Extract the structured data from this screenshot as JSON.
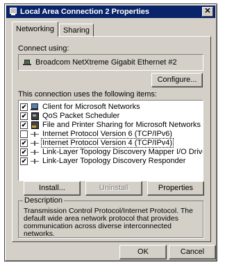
{
  "window": {
    "title": "Local Area Connection 2 Properties",
    "close_glyph": "✕"
  },
  "tabs": [
    {
      "label": "Networking",
      "active": true
    },
    {
      "label": "Sharing",
      "active": false
    }
  ],
  "connect_using": {
    "label": "Connect using:",
    "adapter": "Broadcom NetXtreme Gigabit Ethernet #2",
    "configure_label": "Configure..."
  },
  "items_section": {
    "label": "This connection uses the following items:",
    "items": [
      {
        "label": "Client for Microsoft Networks",
        "checked": true,
        "icon": "network-client-icon",
        "selected": false
      },
      {
        "label": "QoS Packet Scheduler",
        "checked": true,
        "icon": "service-icon",
        "selected": false
      },
      {
        "label": "File and Printer Sharing for Microsoft Networks",
        "checked": true,
        "icon": "service-icon",
        "selected": false
      },
      {
        "label": "Internet Protocol Version 6 (TCP/IPv6)",
        "checked": false,
        "icon": "protocol-icon",
        "selected": false
      },
      {
        "label": "Internet Protocol Version 4 (TCP/IPv4)",
        "checked": true,
        "icon": "protocol-icon",
        "selected": true
      },
      {
        "label": "Link-Layer Topology Discovery Mapper I/O Driver",
        "checked": true,
        "icon": "protocol-icon",
        "selected": false
      },
      {
        "label": "Link-Layer Topology Discovery Responder",
        "checked": true,
        "icon": "protocol-icon",
        "selected": false
      }
    ]
  },
  "item_buttons": {
    "install": "Install...",
    "uninstall": "Uninstall",
    "properties": "Properties"
  },
  "description": {
    "legend": "Description",
    "text": "Transmission Control Protocol/Internet Protocol. The default wide area network protocol that provides communication across diverse interconnected networks."
  },
  "dialog_buttons": {
    "ok": "OK",
    "cancel": "Cancel"
  }
}
